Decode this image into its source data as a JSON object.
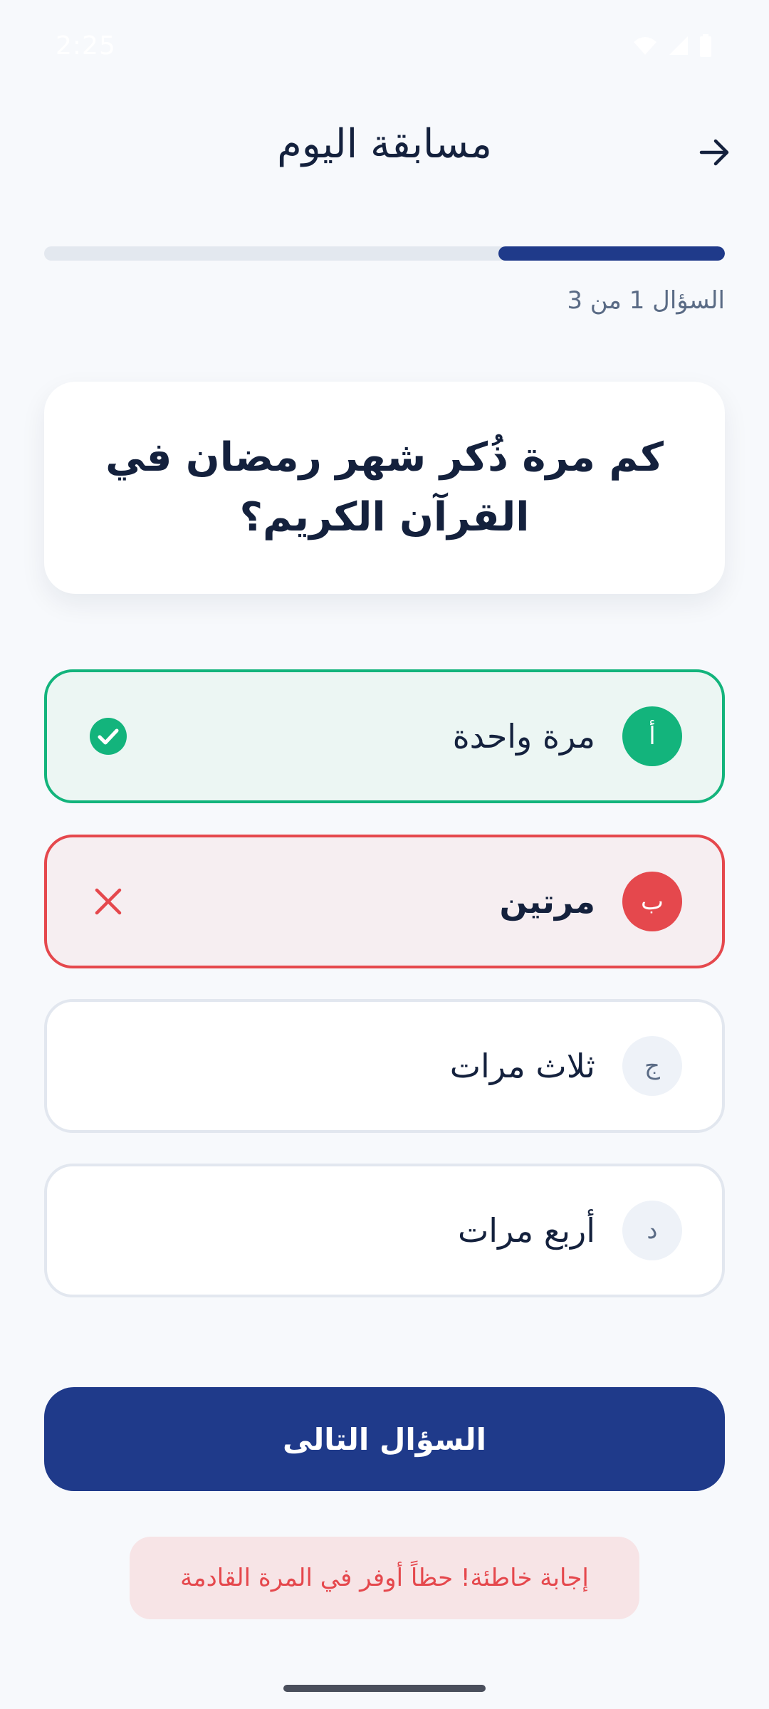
{
  "status_bar": {
    "time": "2:25"
  },
  "header": {
    "title": "مسابقة اليوم",
    "back_icon": "arrow-right-icon"
  },
  "progress": {
    "label": "السؤال 1 من 3",
    "fraction": 0.333
  },
  "question": {
    "text": "كم مرة ذُكر شهر رمضان في القرآن الكريم؟"
  },
  "options": [
    {
      "letter": "أ",
      "text": "مرة واحدة",
      "state": "correct",
      "icon": "check-circle-icon"
    },
    {
      "letter": "ب",
      "text": "مرتين",
      "state": "wrong",
      "icon": "x-icon"
    },
    {
      "letter": "ج",
      "text": "ثلاث مرات",
      "state": "neutral"
    },
    {
      "letter": "د",
      "text": "أربع مرات",
      "state": "neutral"
    }
  ],
  "next_button": {
    "label": "السؤال التالى"
  },
  "feedback": {
    "text": "إجابة خاطئة! حظاً أوفر في المرة القادمة"
  },
  "colors": {
    "primary": "#1F3A8A",
    "correct": "#13B47C",
    "wrong": "#E5484D",
    "background": "#F7F9FC"
  }
}
